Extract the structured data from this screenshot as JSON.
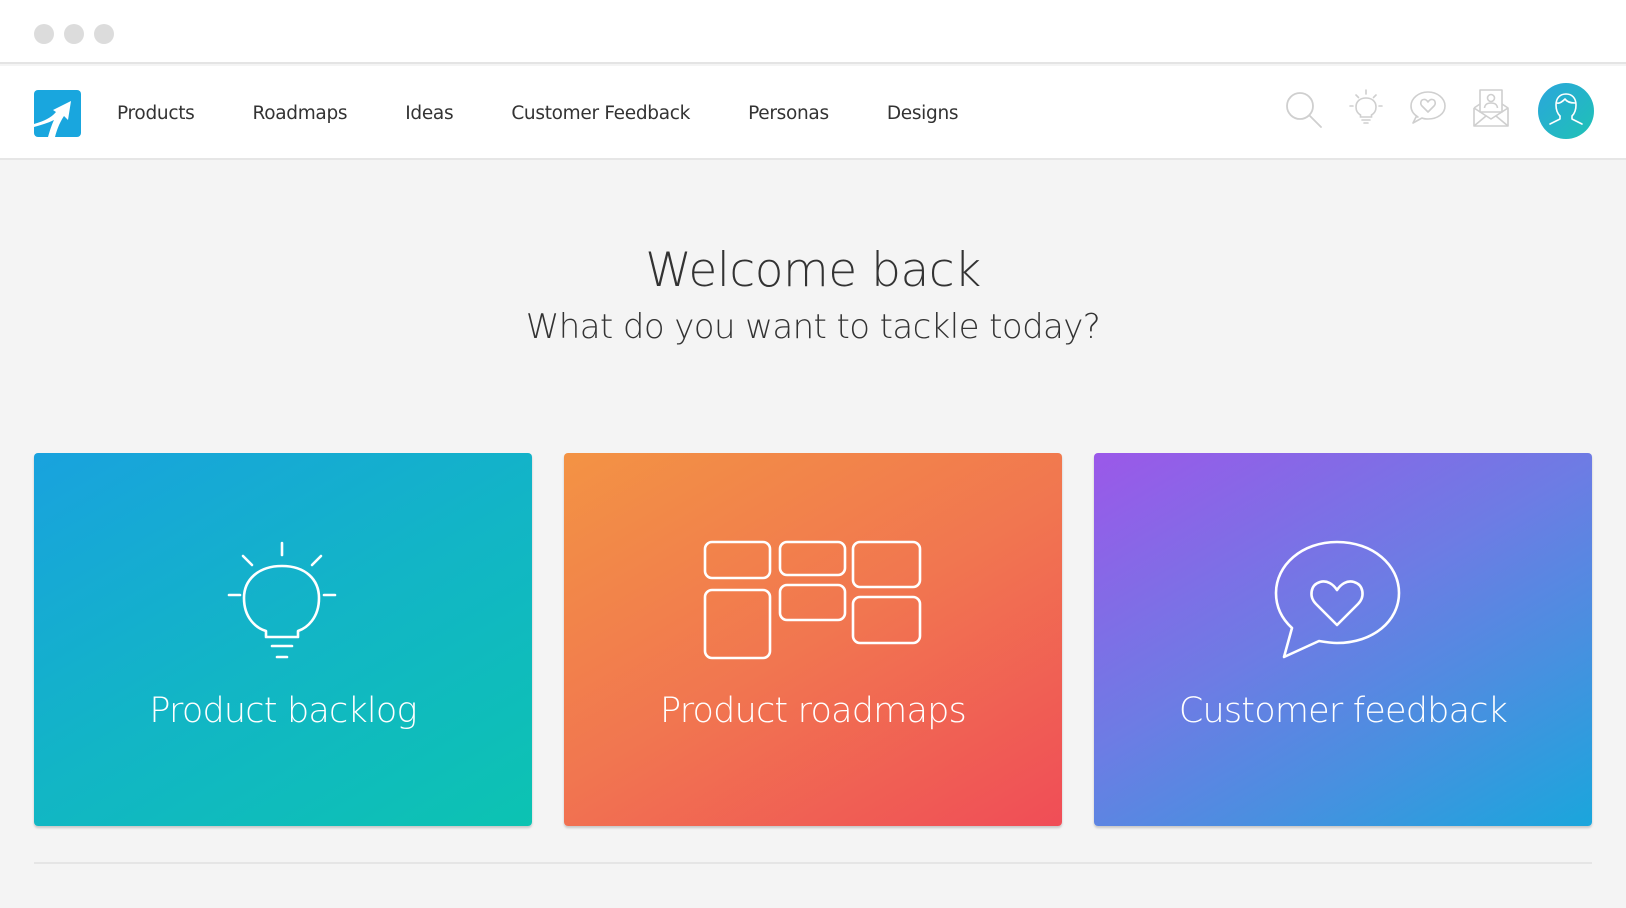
{
  "window": {
    "controls": [
      "close",
      "minimize",
      "maximize"
    ]
  },
  "navbar": {
    "logo": {
      "icon": "arrow-up-right-logo-icon",
      "color": "#19a6de"
    },
    "items": [
      {
        "label": "Products"
      },
      {
        "label": "Roadmaps"
      },
      {
        "label": "Ideas"
      },
      {
        "label": "Customer Feedback"
      },
      {
        "label": "Personas"
      },
      {
        "label": "Designs"
      }
    ],
    "icons": [
      {
        "name": "search-icon"
      },
      {
        "name": "lightbulb-icon"
      },
      {
        "name": "chat-heart-icon"
      },
      {
        "name": "envelope-person-icon"
      }
    ],
    "avatar": {
      "icon": "user-icon",
      "color_start": "#2aa6dc",
      "color_end": "#1fc2b5"
    }
  },
  "welcome": {
    "title": "Welcome back",
    "subtitle": "What do you want to tackle today?"
  },
  "cards": [
    {
      "label": "Product backlog",
      "icon": "lightbulb-icon",
      "color_start": "#19a2de",
      "color_end": "#0cc3b2"
    },
    {
      "label": "Product roadmaps",
      "icon": "roadmap-grid-icon",
      "color_start": "#f39344",
      "color_end": "#f04d57"
    },
    {
      "label": "Customer feedback",
      "icon": "chat-heart-icon",
      "color_start": "#9b58e9",
      "color_end": "#1aa6dc"
    }
  ]
}
